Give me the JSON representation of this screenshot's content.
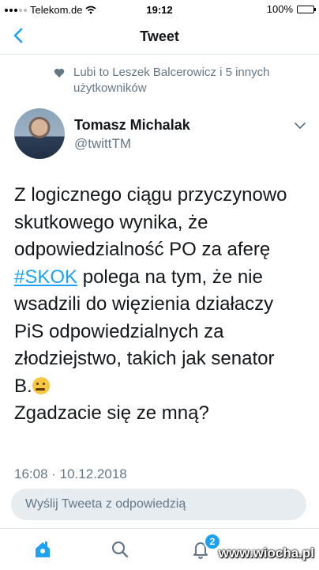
{
  "status_bar": {
    "carrier": "Telekom.de",
    "time": "19:12",
    "battery": "100%"
  },
  "nav": {
    "title": "Tweet"
  },
  "social_context": {
    "text": "Lubi to Leszek Balcerowicz i 5 innych użytkowników"
  },
  "author": {
    "name": "Tomasz Michalak",
    "handle": "@twittTM"
  },
  "tweet": {
    "line1": "Z logicznego ciągu przyczynowo",
    "line2": "skutkowego wynika, że",
    "line3": "odpowiedzialność PO za aferę",
    "hashtag": "#SKOK",
    "line4_rest": " polega na tym, że nie",
    "line5": "wsadzili do więzienia działaczy",
    "line6": "PiS odpowiedzialnych za",
    "line7": "złodziejstwo, takich jak senator",
    "line8": "B.",
    "line9": "Zgadzacie się ze mną?",
    "timestamp": "16:08 · 10.12.2018"
  },
  "reply": {
    "placeholder": "Wyślij Tweeta z odpowiedzią"
  },
  "tabbar": {
    "notifications_badge": "2"
  },
  "watermark": "www.wiocha.pl",
  "colors": {
    "accent": "#1da1f2",
    "secondary_text": "#657786",
    "reply_bg": "#e6ecf0"
  },
  "icons": [
    "wifi-icon",
    "back-chevron-icon",
    "heart-icon",
    "chevron-down-icon",
    "home-icon",
    "search-icon",
    "notifications-bell-icon",
    "thinking-face-emoji"
  ]
}
